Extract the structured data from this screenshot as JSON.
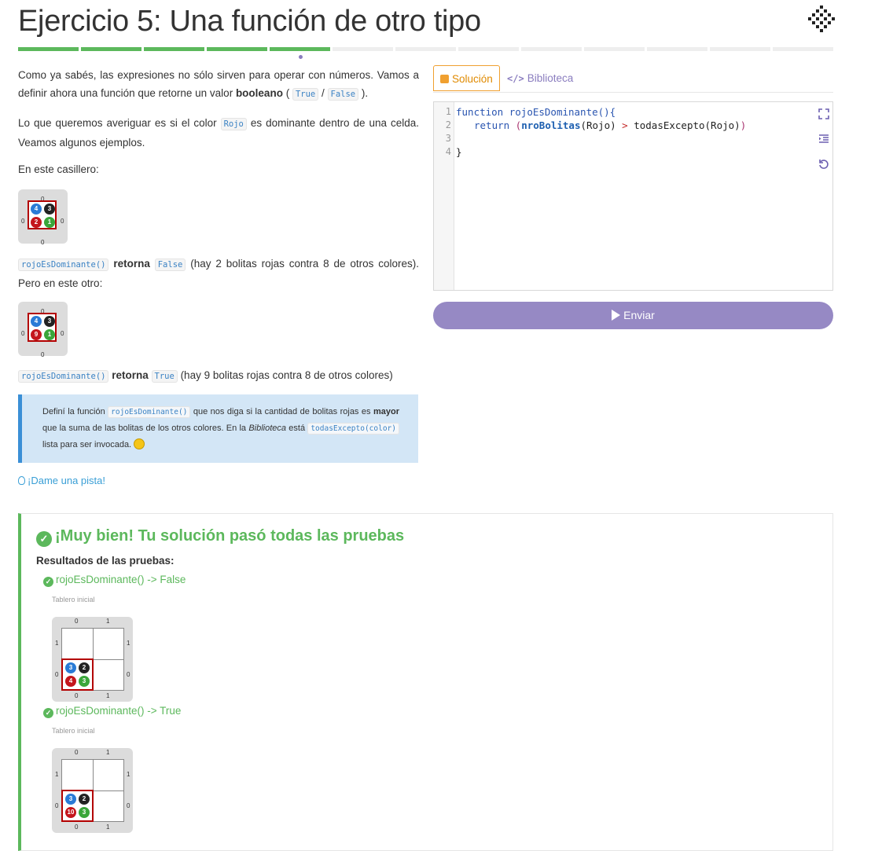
{
  "page": {
    "title": "Ejercicio 5: Una función de otro tipo"
  },
  "progress": {
    "segments_total": 13,
    "segments_done": 5
  },
  "intro": {
    "p1_a": "Como ya sabés, las expresiones no sólo sirven para operar con números. Vamos a definir ahora una función que retorne un valor ",
    "p1_bold": "booleano",
    "p1_b": " ( ",
    "true_code": "True",
    "slash": " / ",
    "false_code": "False",
    "p1_end": " ).",
    "p2_a": "Lo que queremos averiguar es si el color ",
    "rojo_code": "Rojo",
    "p2_b": " es dominante dentro de una celda. Veamos algunos ejemplos.",
    "p3": "En este casillero:",
    "p4_code": "rojoEsDominante()",
    "p4_bold": "retorna",
    "p4_false": "False",
    "p4_rest": " (hay 2 bolitas rojas contra 8 de otros colores). Pero en este otro:",
    "p5_code": "rojoEsDominante()",
    "p5_bold": "retorna",
    "p5_true": "True",
    "p5_rest": " (hay 9 bolitas rojas contra 8 de otros colores)"
  },
  "examples": [
    {
      "top": "0",
      "left": "0",
      "right": "0",
      "bottom": "0",
      "blue": "4",
      "black": "3",
      "red": "2",
      "green": "1"
    },
    {
      "top": "0",
      "left": "0",
      "right": "0",
      "bottom": "0",
      "blue": "4",
      "black": "3",
      "red": "9",
      "green": "1"
    }
  ],
  "notice": {
    "a": "Definí la función ",
    "code1": "rojoEsDominante()",
    "b": " que nos diga si la cantidad de bolitas rojas es ",
    "bold": "mayor",
    "c": " que la suma de las bolitas de los otros colores. En la ",
    "italic": "Biblioteca",
    "d": " está ",
    "code2": "todasExcepto(color)",
    "e": " lista para ser invocada. "
  },
  "hint": "¡Dame una pista!",
  "tabs": {
    "solucion": "Solución",
    "biblioteca": "Biblioteca",
    "biblioteca_icon": "</>"
  },
  "editor": {
    "line_numbers": [
      "1",
      "2",
      "3",
      "4"
    ],
    "l1_kw": "function",
    "l1_rest": " rojoEsDominante(){",
    "l2_kw": "return",
    "l2_p1": " (",
    "l2_fn": "nroBolitas",
    "l2_p2": "(Rojo) ",
    "l2_op": ">",
    "l2_p3": " todasExcepto(Rojo)",
    "l2_p4": ")",
    "l4": "}",
    "tools": [
      "fullscreen-icon",
      "indent-icon",
      "reset-icon"
    ]
  },
  "submit": "Enviar",
  "results": {
    "title": "¡Muy bien! Tu solución pasó todas las pruebas",
    "subtitle": "Resultados de las pruebas:",
    "tests": [
      {
        "label": "rojoEsDominante() -> False",
        "board_label": "Tablero inicial",
        "col0": "0",
        "col1": "1",
        "row1": "1",
        "row0": "0",
        "blue": "3",
        "black": "2",
        "red": "4",
        "green": "3"
      },
      {
        "label": "rojoEsDominante() -> True",
        "board_label": "Tablero inicial",
        "col0": "0",
        "col1": "1",
        "row1": "1",
        "row0": "0",
        "blue": "3",
        "black": "2",
        "red": "10",
        "green": "3"
      }
    ]
  },
  "colors": {
    "green": "#5cb85c",
    "purple": "#9689c4",
    "orange": "#f0a030",
    "blue_link": "#3a9fd6"
  }
}
